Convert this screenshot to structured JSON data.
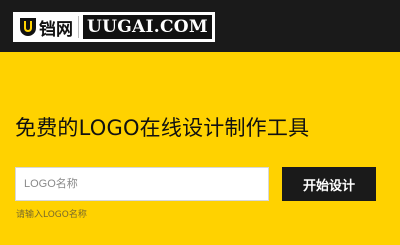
{
  "header": {
    "logo_cn": "铛网",
    "logo_en": "UUGAI.COM",
    "logo_icon": "shield-u-icon"
  },
  "main": {
    "title": "免费的LOGO在线设计制作工具",
    "input_placeholder": "LOGO名称",
    "input_value": "",
    "submit_label": "开始设计",
    "hint": "请输入LOGO名称"
  },
  "colors": {
    "background": "#ffd200",
    "topbar": "#1a1a1a",
    "button": "#1a1a1a",
    "button_text": "#ffffff"
  }
}
